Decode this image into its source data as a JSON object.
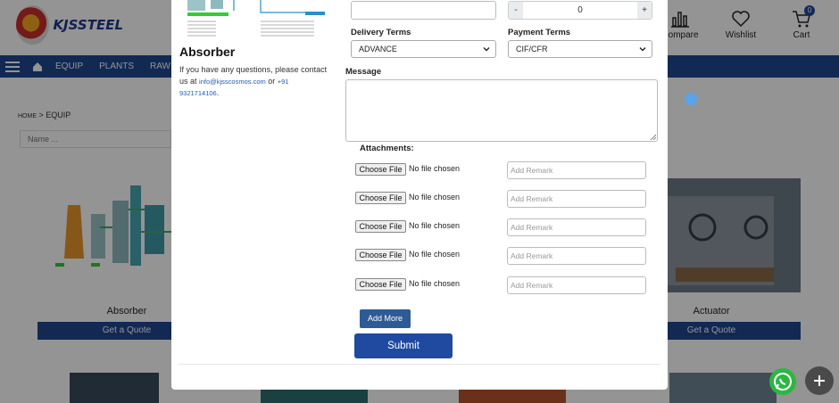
{
  "brand": {
    "name": "KJSSTEEL"
  },
  "header": {
    "actions": [
      {
        "label": "Compare",
        "icon": "bar-chart-icon"
      },
      {
        "label": "Wishlist",
        "icon": "heart-icon"
      },
      {
        "label": "Cart",
        "icon": "cart-icon",
        "badge": "0"
      }
    ]
  },
  "nav": {
    "items": [
      "EQUIP",
      "PLANTS",
      "RAW"
    ]
  },
  "breadcrumb": {
    "home": "HOME",
    "current": "> EQUIP"
  },
  "filter": {
    "placeholder": "Name ..."
  },
  "cards": [
    {
      "title": "Absorber",
      "cta": "Get a Quote"
    },
    {
      "title": "Actuator",
      "cta": "Get a Quote"
    }
  ],
  "modal": {
    "product_title": "Absorber",
    "contact": {
      "intro": "If you have any questions, please contact us at",
      "email": "info@kjsscosmos.com",
      "or": "or",
      "phone": "+91 9321714106",
      "period": "."
    },
    "quantity": {
      "minus": "-",
      "value": "0",
      "plus": "+"
    },
    "delivery_terms": {
      "label": "Delivery Terms",
      "selected": "ADVANCE"
    },
    "payment_terms": {
      "label": "Payment Terms",
      "selected": "CIF/CFR"
    },
    "message": {
      "label": "Message"
    },
    "attachments": {
      "label": "Attachments:",
      "choose_label": "Choose File",
      "no_file": "No file chosen",
      "remark_placeholder": "Add Remark"
    },
    "add_more": "Add More",
    "submit": "Submit"
  },
  "colors": {
    "primary": "#1f4aa0",
    "nav": "#1e4790",
    "whatsapp": "#2bb742"
  }
}
